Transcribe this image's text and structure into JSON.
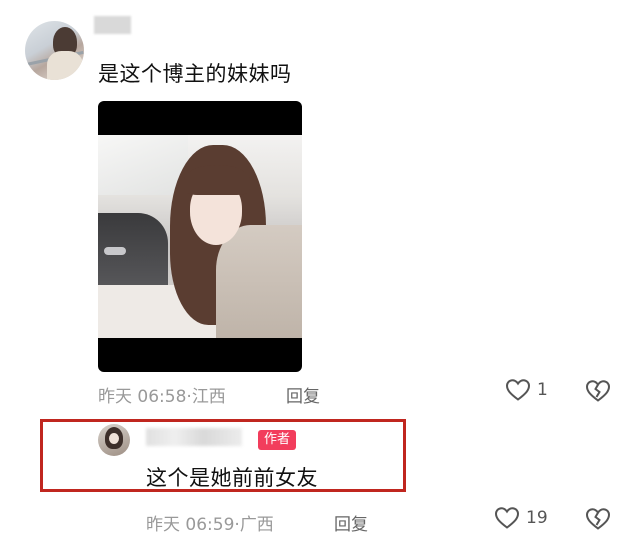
{
  "comment": {
    "text": "是这个博主的妹妹吗",
    "time": "昨天 06:58",
    "location": "江西",
    "reply_label": "回复",
    "like_count": "1",
    "icons": [
      "heart-icon",
      "heart-broken-icon"
    ]
  },
  "reply": {
    "author_badge": "作者",
    "text": "这个是她前前女友",
    "time": "昨天 06:59",
    "location": "广西",
    "reply_label": "回复",
    "like_count": "19",
    "icons": [
      "heart-icon",
      "heart-broken-icon"
    ]
  },
  "colors": {
    "badge": "#f23d5c",
    "highlight_border": "#c0261f",
    "meta_text": "#999999"
  }
}
